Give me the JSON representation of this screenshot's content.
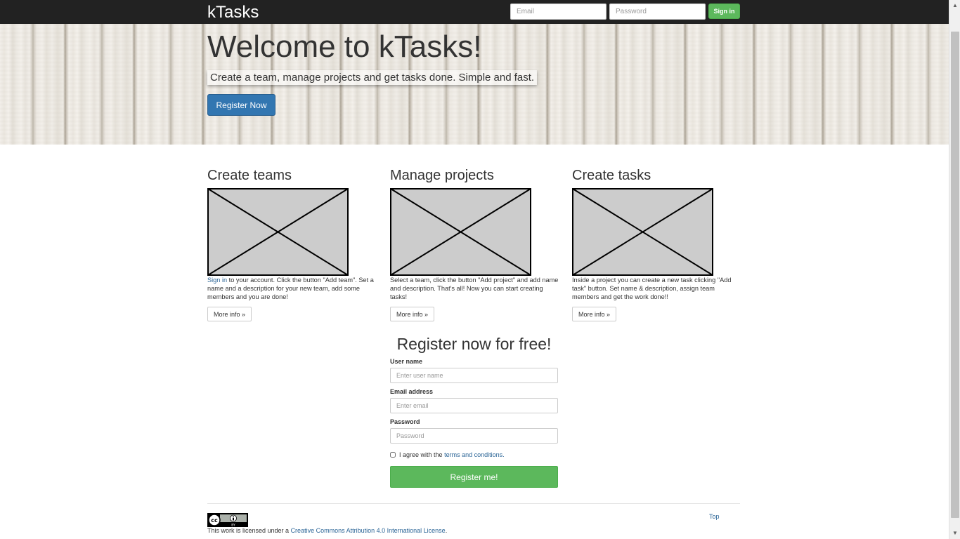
{
  "navbar": {
    "brand": "kTasks",
    "email_placeholder": "Email",
    "password_placeholder": "Password",
    "signin_label": "Sign in"
  },
  "hero": {
    "title": "Welcome to kTasks!",
    "subtitle": "Create a team, manage projects and get tasks done. Simple and fast.",
    "register_label": "Register Now"
  },
  "features": [
    {
      "title": "Create teams",
      "link_text": "Sign in",
      "text": " to your account. Click the button \"Add team\". Set a name and a description for your new team, add some members and you are done!",
      "button": "More info »"
    },
    {
      "title": "Manage projects",
      "text": "Select a team, click the button \"Add project\" and add name and description. That's all! Now you can start creating tasks!",
      "button": "More info »"
    },
    {
      "title": "Create tasks",
      "text": "Inside a project you can create a new task clicking \"Add task\" button. Set name & description, assign team members and get the work done!!",
      "button": "More info »"
    }
  ],
  "register": {
    "title": "Register now for free!",
    "username_label": "User name",
    "username_placeholder": "Enter user name",
    "email_label": "Email address",
    "email_placeholder": "Enter email",
    "password_label": "Password",
    "password_placeholder": "Password",
    "agree_text": "I agree with the ",
    "terms_link": "terms and conditions.",
    "submit_label": "Register me!"
  },
  "footer": {
    "license_prefix": "This work is licensed under a ",
    "license_link": "Creative Commons Attribution 4.0 International License",
    "license_suffix": ".",
    "top_link": "Top",
    "badge_text": "BY"
  },
  "colors": {
    "navbar": "#222222",
    "primary": "#3276b1",
    "success": "#5cb85c",
    "link": "#2a6496"
  },
  "icons": {
    "scroll_up": "scroll-up-arrow-icon",
    "scroll_down": "scroll-down-arrow-icon",
    "license_badge": "cc-by-badge-icon",
    "feature_image": "image-placeholder-icon"
  }
}
